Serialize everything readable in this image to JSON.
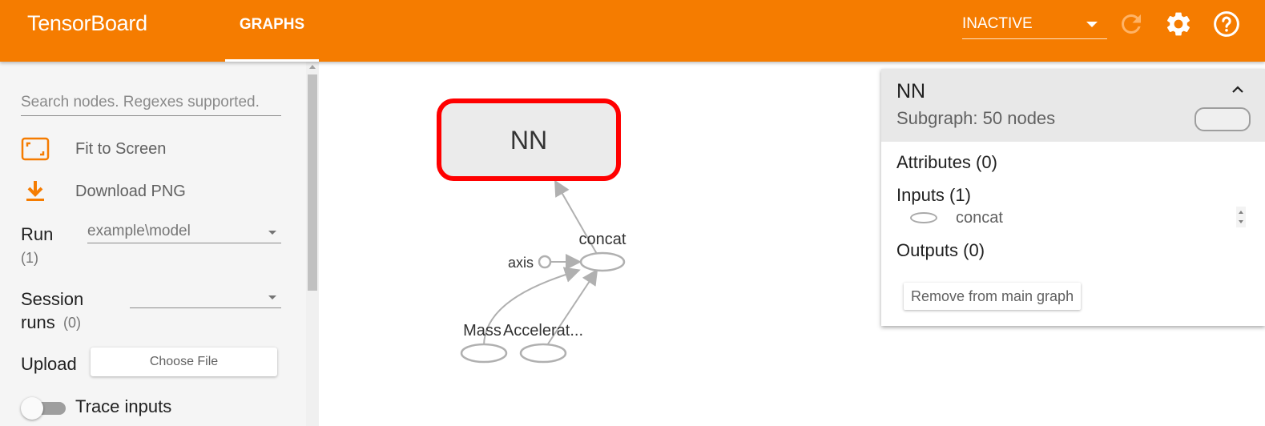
{
  "header": {
    "brand": "TensorBoard",
    "tab_label": "GRAPHS",
    "run_status": "INACTIVE",
    "icons": [
      "refresh-icon",
      "settings-icon",
      "help-icon"
    ],
    "colors": {
      "bar": "#f57c00"
    }
  },
  "sidebar": {
    "search_placeholder": "Search nodes. Regexes supported.",
    "fit_label": "Fit to Screen",
    "download_label": "Download PNG",
    "run_label": "Run",
    "run_count": "(1)",
    "run_value": "example\\model",
    "session_label_1": "Session",
    "session_label_2": "runs",
    "session_count": "(0)",
    "session_value": "",
    "upload_label": "Upload",
    "choose_file_label": "Choose File",
    "trace_label": "Trace inputs"
  },
  "graph": {
    "nodes": {
      "nn": "NN",
      "concat": "concat",
      "axis": "axis",
      "mass": "Mass",
      "accel": "Accelerat..."
    },
    "colors": {
      "selected_outline": "#ff0000",
      "edge": "#b0b0b0"
    }
  },
  "info": {
    "title": "NN",
    "subtitle": "Subgraph: 50 nodes",
    "attributes": "Attributes (0)",
    "inputs": "Inputs (1)",
    "input_item": "concat",
    "outputs": "Outputs (0)",
    "remove_label": "Remove from main graph"
  }
}
